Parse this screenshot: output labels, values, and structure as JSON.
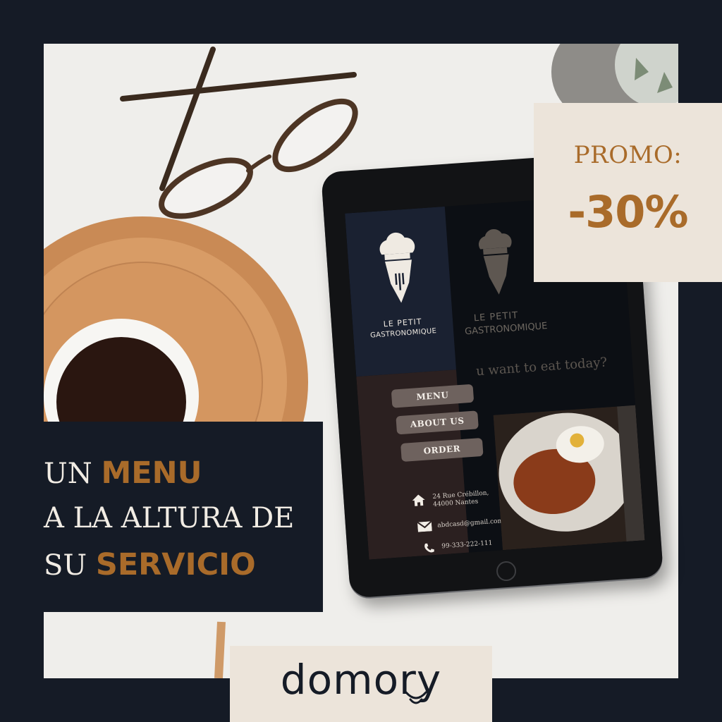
{
  "promo": {
    "label": "PROMO:",
    "value": "-30%"
  },
  "headline": {
    "line1_plain": "UN",
    "line1_accent": "MENU",
    "line2": "A LA ALTURA DE",
    "line3_plain": "SU",
    "line3_accent": "SERVICIO"
  },
  "brand": {
    "name": "domory"
  },
  "tablet_site": {
    "logo_line1": "LE PETIT",
    "logo_line2": "GASTRONOMIQUE",
    "hero_question": "u want to eat today?",
    "nav": {
      "menu": "MENU",
      "about": "ABOUT US",
      "order": "ORDER"
    },
    "contact": {
      "address_line1": "24 Rue Crébillon,",
      "address_line2": "44000 Nantes",
      "email": "abdcasd@gmail.com",
      "phone": "99-333-222-111"
    },
    "icons": [
      "home-icon",
      "mail-icon",
      "phone-icon",
      "chef-pen-logo-icon"
    ]
  },
  "colors": {
    "navy": "#151b26",
    "accent": "#a96b2a",
    "cream": "#ece4da"
  }
}
